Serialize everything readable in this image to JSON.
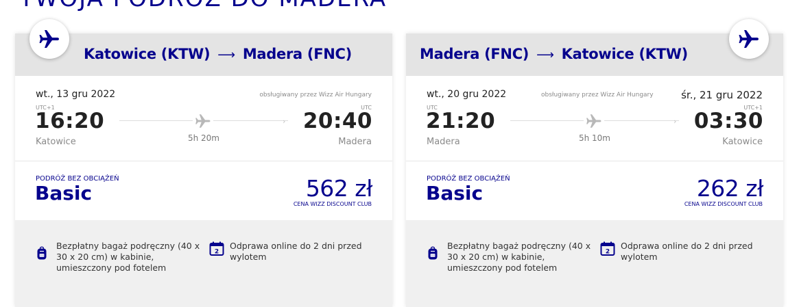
{
  "page": {
    "heading": "TWOJA PODRÓŻ DO MADERA"
  },
  "colors": {
    "brand": "#06038d",
    "header_bg": "#e4e4e4",
    "panel_bg": "#f0f0f0"
  },
  "icons": {
    "badge": "airplane-icon",
    "route": "plane-icon",
    "bag": "backpack-icon",
    "checkin": "calendar-icon"
  },
  "flights": [
    {
      "origin": "Katowice (KTW)",
      "arrow": "⟶",
      "destination": "Madera (FNC)",
      "departure_date": "wt., 13 gru 2022",
      "arrival_date": "",
      "operator": "obsługiwany przez Wizz Air Hungary",
      "departure_tz": "UTC+1",
      "arrival_tz": "UTC",
      "departure_time": "16:20",
      "arrival_time": "20:40",
      "departure_city": "Katowice",
      "arrival_city": "Madera",
      "duration": "5h 20m",
      "fare_label": "PODRÓŻ BEZ OBCIĄŻEŃ",
      "fare_name": "Basic",
      "price": "562 zł",
      "price_note": "CENA WIZZ DISCOUNT CLUB",
      "benefit_bag": "Bezpłatny bagaż podręczny (40 x 30 x 20 cm) w kabinie, umieszczony pod fotelem",
      "benefit_checkin": "Odprawa online do 2 dni przed wylotem",
      "checkin_days": "2"
    },
    {
      "origin": "Madera (FNC)",
      "arrow": "⟶",
      "destination": "Katowice (KTW)",
      "departure_date": "wt., 20 gru 2022",
      "arrival_date": "śr., 21 gru 2022",
      "operator": "obsługiwany przez Wizz Air Hungary",
      "departure_tz": "UTC",
      "arrival_tz": "UTC+1",
      "departure_time": "21:20",
      "arrival_time": "03:30",
      "departure_city": "Madera",
      "arrival_city": "Katowice",
      "duration": "5h 10m",
      "fare_label": "PODRÓŻ BEZ OBCIĄŻEŃ",
      "fare_name": "Basic",
      "price": "262 zł",
      "price_note": "CENA WIZZ DISCOUNT CLUB",
      "benefit_bag": "Bezpłatny bagaż podręczny (40 x 30 x 20 cm) w kabinie, umieszczony pod fotelem",
      "benefit_checkin": "Odprawa online do 2 dni przed wylotem",
      "checkin_days": "2"
    }
  ]
}
